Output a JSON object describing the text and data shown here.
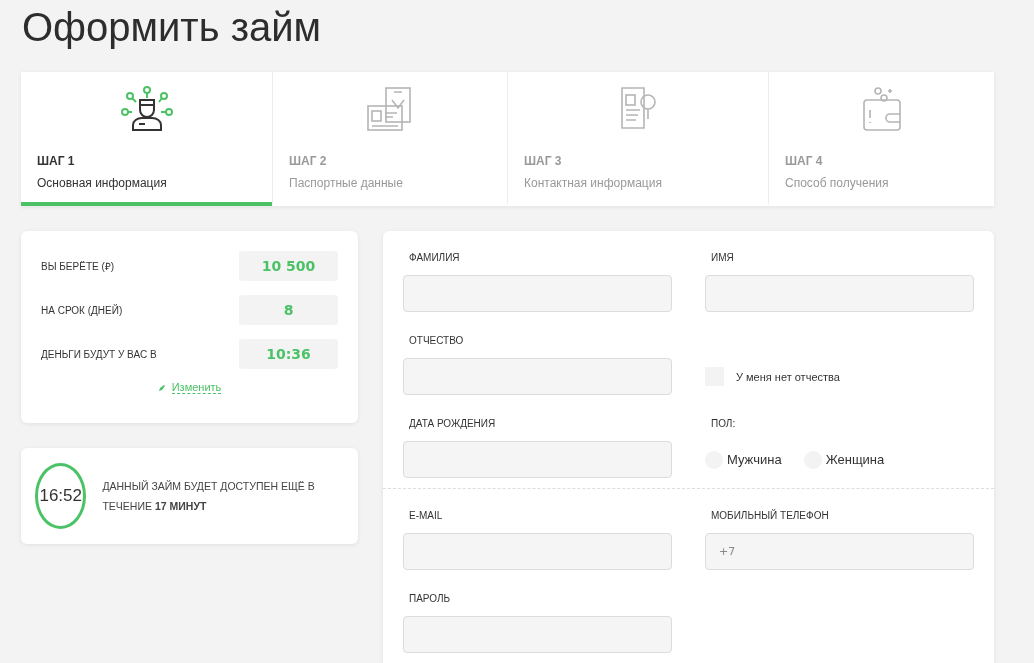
{
  "title": "Оформить займ",
  "steps": [
    {
      "label": "ШАГ 1",
      "caption": "Основная информация",
      "selected": true
    },
    {
      "label": "ШАГ 2",
      "caption": "Паспортные данные",
      "selected": false
    },
    {
      "label": "ШАГ 3",
      "caption": "Контактная информация",
      "selected": false
    },
    {
      "label": "ШАГ 4",
      "caption": "Способ получения",
      "selected": false
    }
  ],
  "summary": {
    "rows": [
      {
        "label": "ВЫ БЕРЁТЕ (₽)",
        "value": "10 500"
      },
      {
        "label": "НА СРОК (ДНЕЙ)",
        "value": "8"
      },
      {
        "label": "ДЕНЬГИ БУДУТ У ВАС В",
        "value": "10:36"
      }
    ],
    "edit_link": "Изменить"
  },
  "timer": {
    "time": "16:52",
    "message": "ДАННЫЙ ЗАЙМ БУДЕТ ДОСТУПЕН ЕЩЁ В ТЕЧЕНИЕ **17 МИНУТ**"
  },
  "form": {
    "sections": [
      {
        "rows": [
          [
            {
              "kind": "field",
              "label": "ФАМИЛИЯ"
            },
            {
              "kind": "field",
              "label": "ИМЯ"
            }
          ],
          [
            {
              "kind": "field",
              "label": "ОТЧЕСТВО"
            },
            {
              "kind": "checkbox",
              "label": "У меня нет отчества",
              "checked": false
            }
          ],
          [
            {
              "kind": "field",
              "label": "ДАТА РОЖДЕНИЯ"
            },
            {
              "kind": "radio",
              "label": "ПОЛ:",
              "options": [
                {
                  "label": "Мужчина",
                  "selected": false
                },
                {
                  "label": "Женщина",
                  "selected": false
                }
              ]
            }
          ]
        ]
      },
      {
        "rows": [
          [
            {
              "kind": "field",
              "label": "E-MAIL"
            },
            {
              "kind": "field",
              "label": "МОБИЛЬНЫЙ ТЕЛЕФОН",
              "placeholder": "+7"
            }
          ],
          [
            {
              "kind": "field",
              "label": "ПАРОЛЬ"
            }
          ]
        ]
      }
    ]
  }
}
